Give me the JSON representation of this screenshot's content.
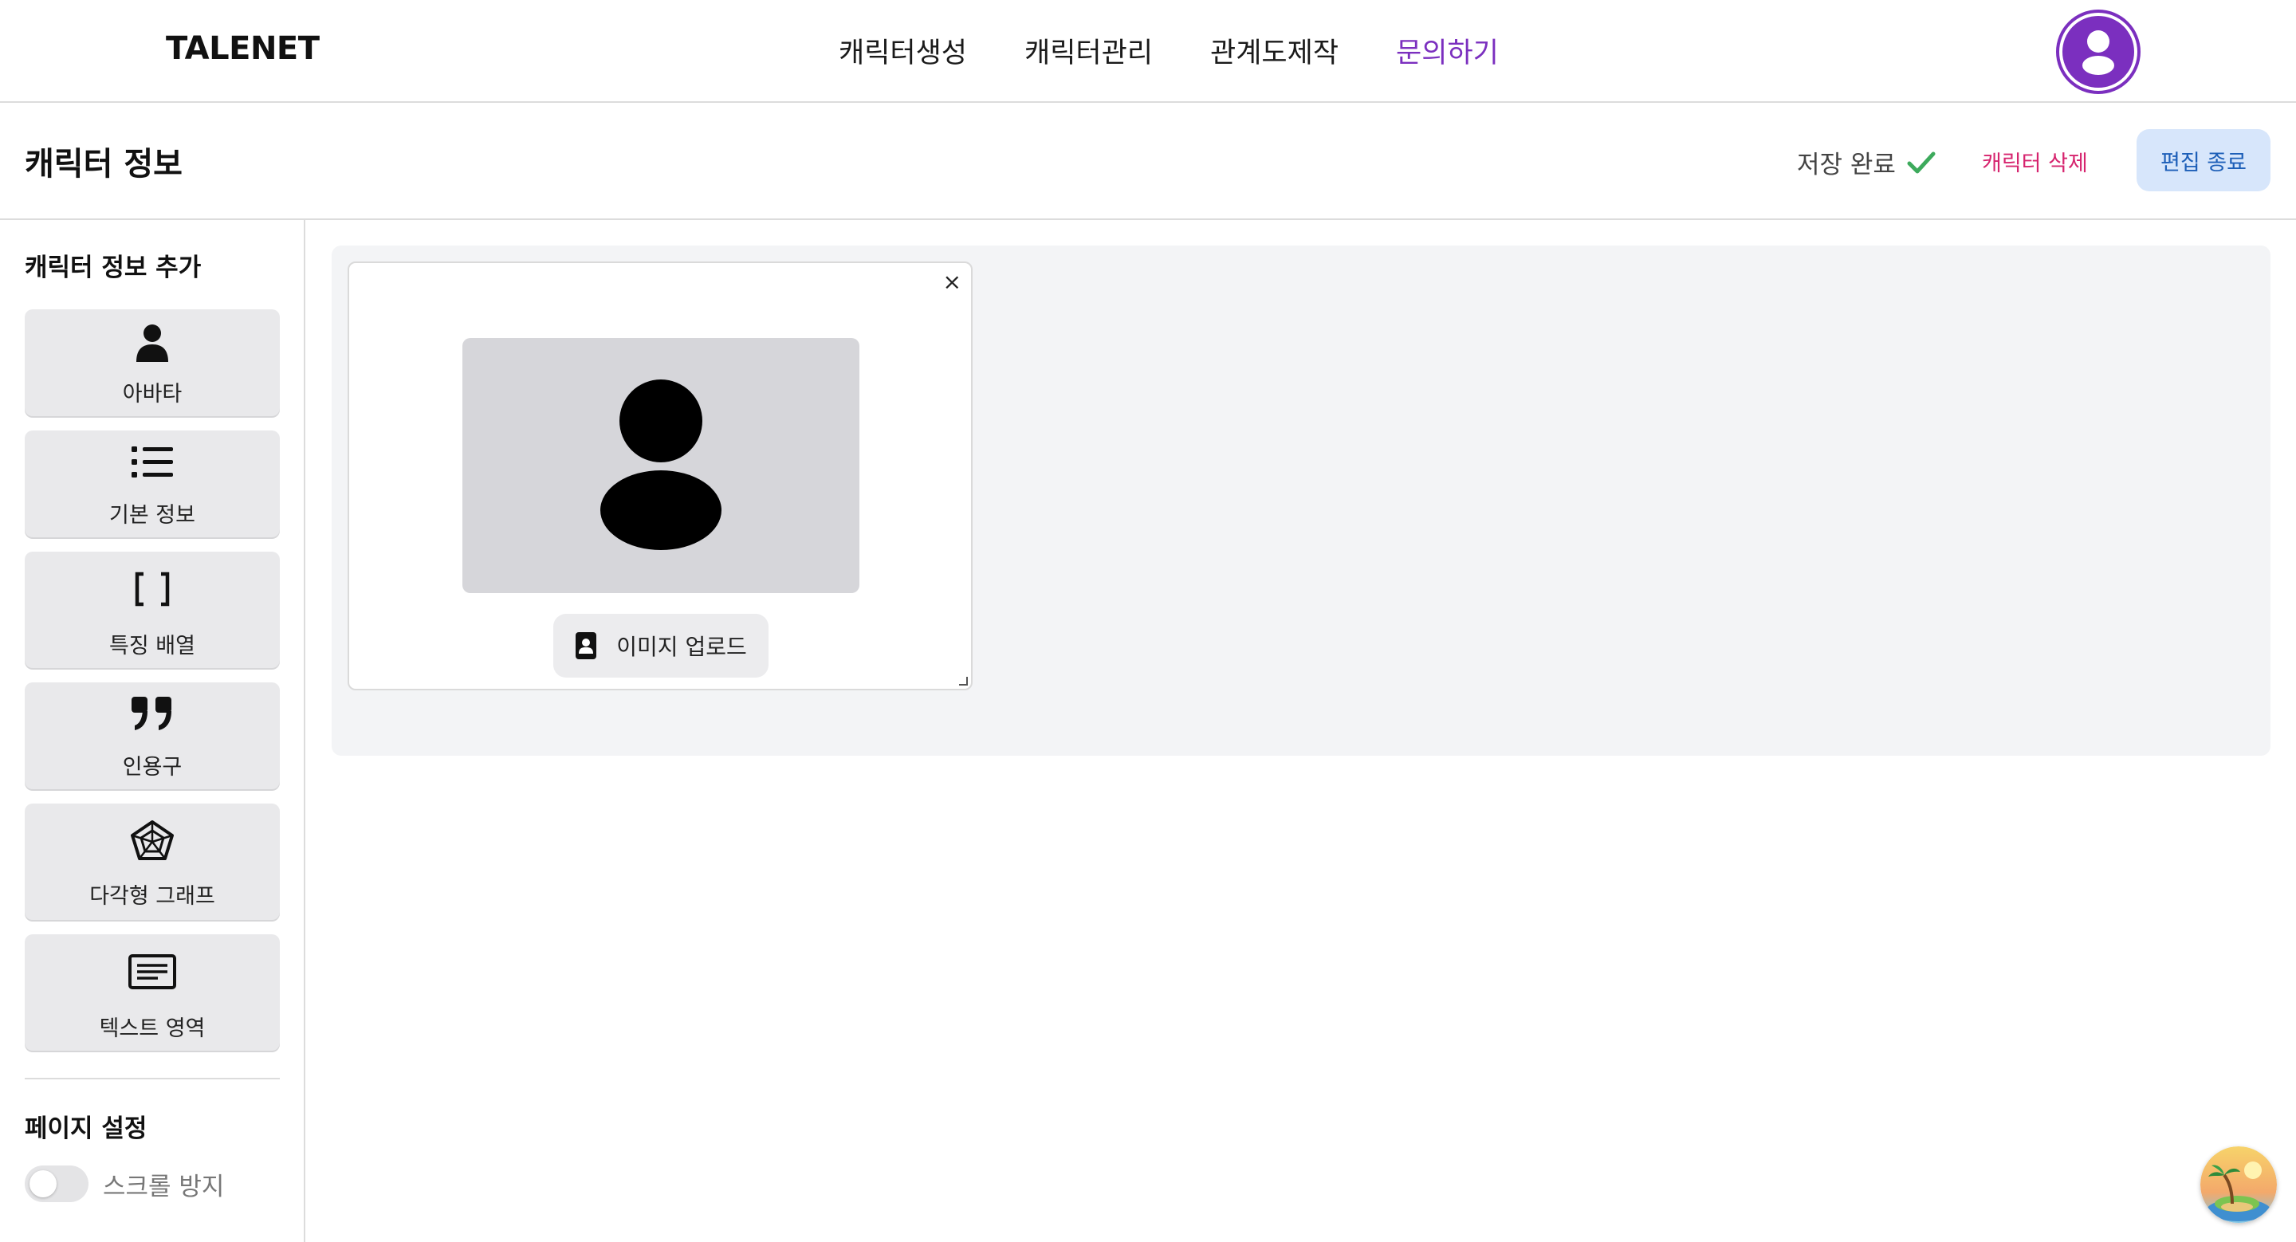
{
  "app": {
    "logo": "TALENET"
  },
  "nav": {
    "items": [
      {
        "label": "캐릭터생성"
      },
      {
        "label": "캐릭터관리"
      },
      {
        "label": "관계도제작"
      },
      {
        "label": "문의하기",
        "active": true
      }
    ]
  },
  "header": {
    "title": "캐릭터 정보",
    "save_status": "저장 완료",
    "delete_label": "캐릭터 삭제",
    "end_edit_label": "편집 종료"
  },
  "sidebar": {
    "add_heading": "캐릭터 정보 추가",
    "tools": [
      {
        "label": "아바타",
        "icon": "user-icon"
      },
      {
        "label": "기본 정보",
        "icon": "list-icon"
      },
      {
        "label": "특징 배열",
        "icon": "brackets-icon"
      },
      {
        "label": "인용구",
        "icon": "quote-icon"
      },
      {
        "label": "다각형 그래프",
        "icon": "pentagon-graph-icon"
      },
      {
        "label": "텍스트 영역",
        "icon": "text-area-icon"
      }
    ],
    "page_settings_heading": "페이지 설정",
    "scroll_lock_label": "스크롤 방지",
    "scroll_lock_on": false
  },
  "canvas": {
    "avatar_card": {
      "close_symbol": "×",
      "upload_label": "이미지 업로드"
    }
  },
  "colors": {
    "accent": "#7b2fbf",
    "danger": "#d6246e",
    "primary_button_bg": "#d7e6fb",
    "primary_button_text": "#1d5fb8",
    "success": "#3daa5c"
  }
}
